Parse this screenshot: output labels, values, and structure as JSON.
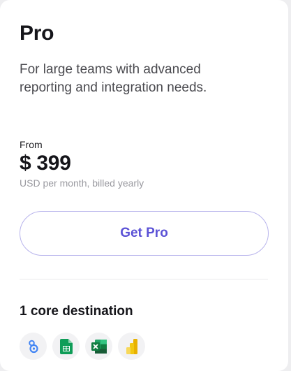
{
  "plan": {
    "name": "Pro",
    "description": "For large teams with advanced reporting and integration needs.",
    "price_prefix": "From",
    "price": "$ 399",
    "price_note": "USD per month, billed yearly",
    "cta_label": "Get Pro"
  },
  "destinations": {
    "heading": "1 core destination",
    "icons": [
      "looker-studio-icon",
      "google-sheets-icon",
      "excel-icon",
      "power-bi-icon"
    ]
  },
  "colors": {
    "accent": "#5b52d6",
    "cta_border": "#b8b4ec",
    "text": "#15151a",
    "muted": "#9a9aa0"
  }
}
